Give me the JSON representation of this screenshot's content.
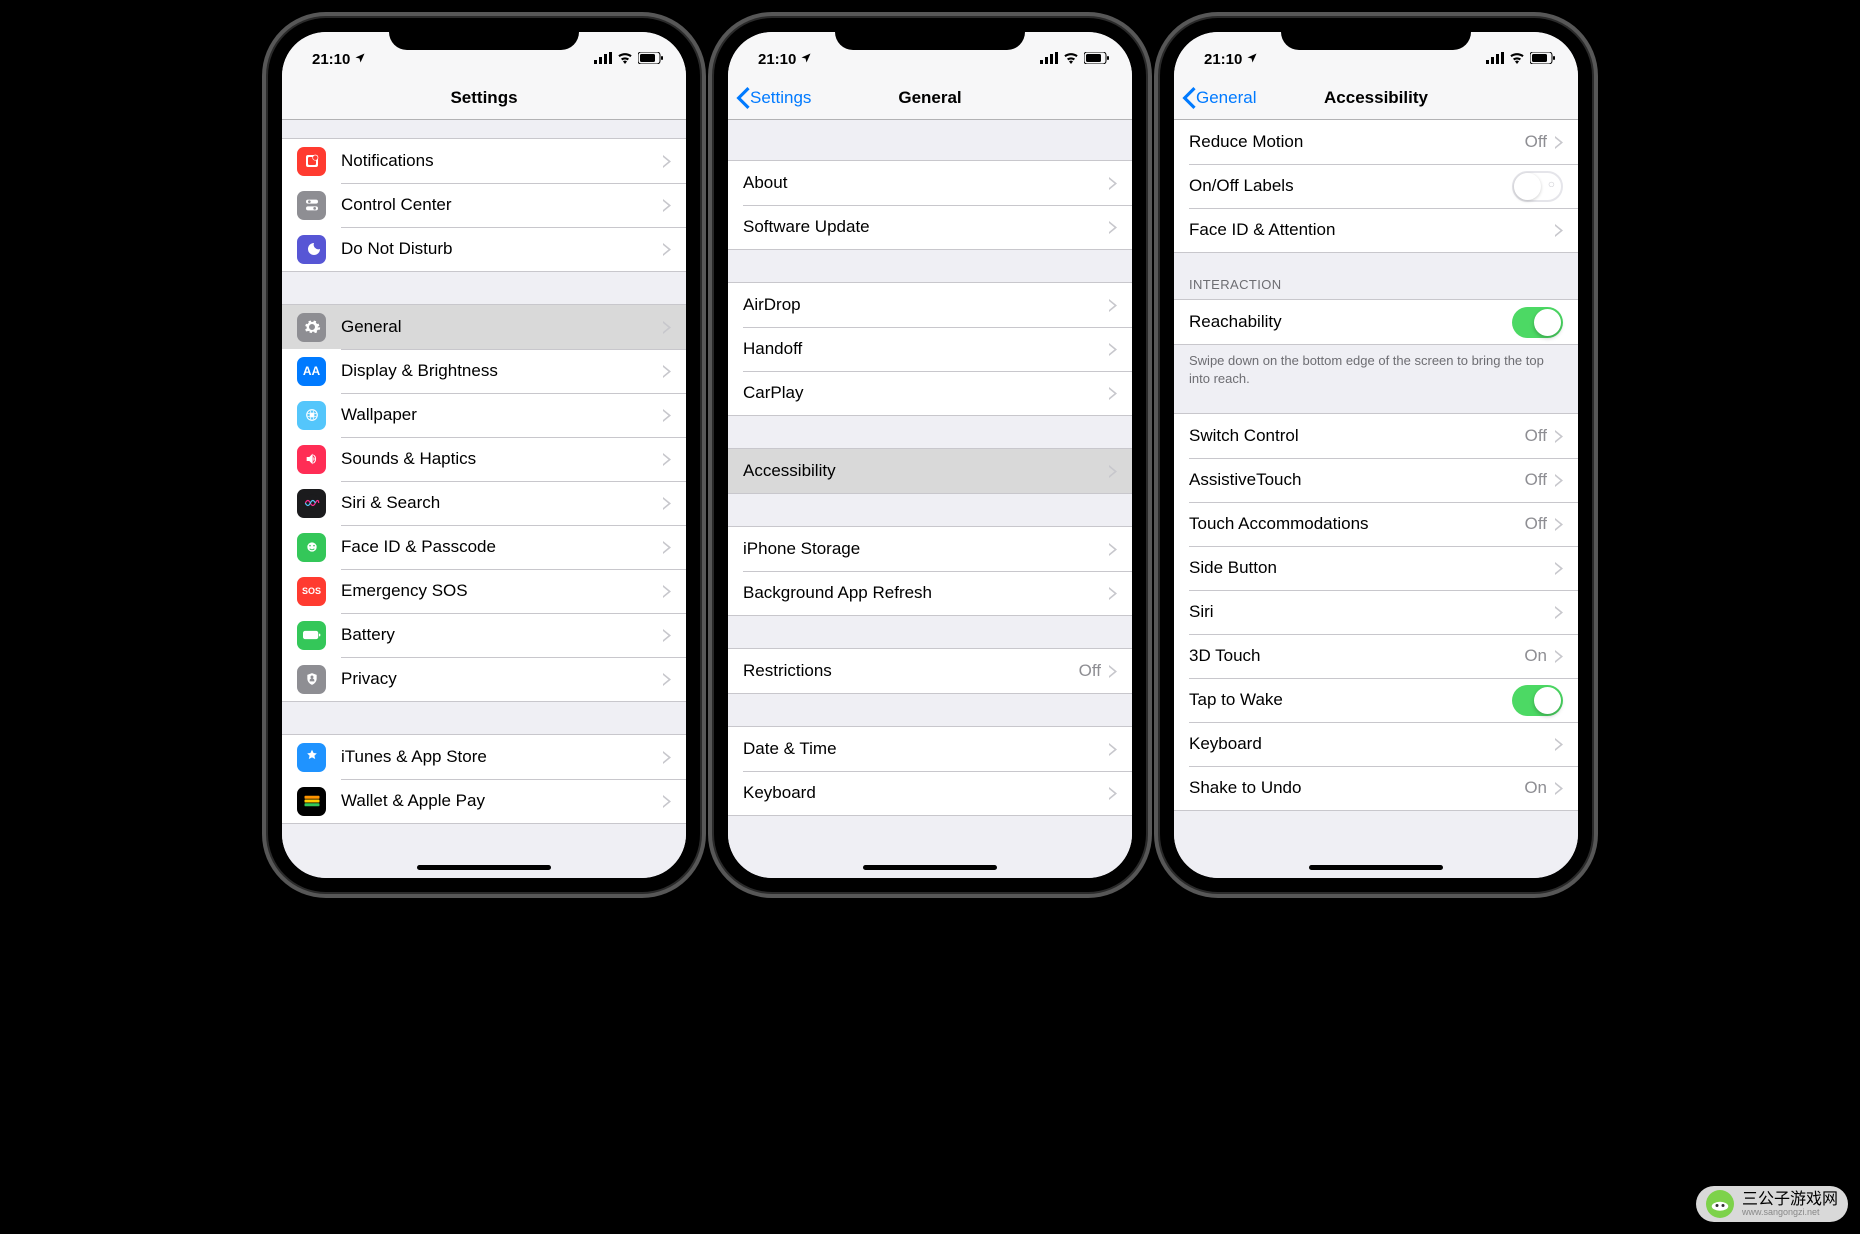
{
  "status": {
    "time": "21:10"
  },
  "phone1": {
    "title": "Settings",
    "g1": [
      {
        "label": "Notifications",
        "icon": "notifications-icon",
        "bg": "#ff3b30"
      },
      {
        "label": "Control Center",
        "icon": "control-center-icon",
        "bg": "#8e8e93"
      },
      {
        "label": "Do Not Disturb",
        "icon": "dnd-icon",
        "bg": "#5756d5"
      }
    ],
    "g2": [
      {
        "label": "General",
        "icon": "gear-icon",
        "bg": "#8e8e93",
        "selected": true
      },
      {
        "label": "Display & Brightness",
        "icon": "display-icon",
        "bg": "#007aff"
      },
      {
        "label": "Wallpaper",
        "icon": "wallpaper-icon",
        "bg": "#54c6fb"
      },
      {
        "label": "Sounds & Haptics",
        "icon": "sounds-icon",
        "bg": "#ff2d55"
      },
      {
        "label": "Siri & Search",
        "icon": "siri-icon",
        "bg": "#1b1b1d"
      },
      {
        "label": "Face ID & Passcode",
        "icon": "faceid-icon",
        "bg": "#34c759"
      },
      {
        "label": "Emergency SOS",
        "icon": "sos-icon",
        "bg": "#ff3b30",
        "text": "SOS"
      },
      {
        "label": "Battery",
        "icon": "battery-icon",
        "bg": "#34c759"
      },
      {
        "label": "Privacy",
        "icon": "privacy-icon",
        "bg": "#8e8e93"
      }
    ],
    "g3": [
      {
        "label": "iTunes & App Store",
        "icon": "appstore-icon",
        "bg": "#1f93ff"
      },
      {
        "label": "Wallet & Apple Pay",
        "icon": "wallet-icon",
        "bg": "#000000"
      }
    ]
  },
  "phone2": {
    "back": "Settings",
    "title": "General",
    "g1": [
      {
        "label": "About"
      },
      {
        "label": "Software Update"
      }
    ],
    "g2": [
      {
        "label": "AirDrop"
      },
      {
        "label": "Handoff"
      },
      {
        "label": "CarPlay"
      }
    ],
    "g3": [
      {
        "label": "Accessibility",
        "selected": true
      }
    ],
    "g4": [
      {
        "label": "iPhone Storage"
      },
      {
        "label": "Background App Refresh"
      }
    ],
    "g5": [
      {
        "label": "Restrictions",
        "value": "Off"
      }
    ],
    "g6": [
      {
        "label": "Date & Time"
      },
      {
        "label": "Keyboard"
      }
    ]
  },
  "phone3": {
    "back": "General",
    "title": "Accessibility",
    "g1": [
      {
        "label": "Reduce Motion",
        "value": "Off"
      },
      {
        "label": "On/Off Labels",
        "switch": "off"
      },
      {
        "label": "Face ID & Attention"
      }
    ],
    "sectionHeader": "INTERACTION",
    "g2": [
      {
        "label": "Reachability",
        "switch": "on"
      }
    ],
    "footer": "Swipe down on the bottom edge of the screen to bring the top into reach.",
    "g3": [
      {
        "label": "Switch Control",
        "value": "Off"
      },
      {
        "label": "AssistiveTouch",
        "value": "Off"
      },
      {
        "label": "Touch Accommodations",
        "value": "Off"
      },
      {
        "label": "Side Button"
      },
      {
        "label": "Siri"
      },
      {
        "label": "3D Touch",
        "value": "On"
      },
      {
        "label": "Tap to Wake",
        "switch": "on"
      },
      {
        "label": "Keyboard"
      },
      {
        "label": "Shake to Undo",
        "value": "On"
      }
    ]
  },
  "watermark": {
    "text": "三公子游戏网",
    "sub": "www.sangongzi.net"
  }
}
